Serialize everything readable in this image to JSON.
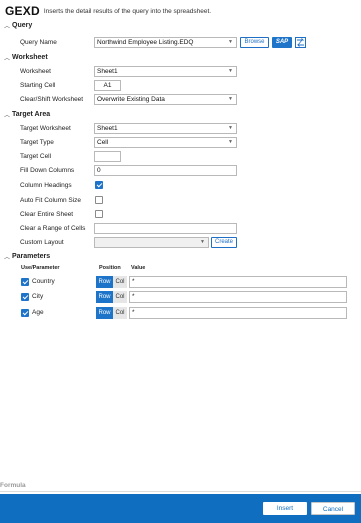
{
  "header": {
    "function_name": "GEXD",
    "description": "Inserts the detail results of the query into the spreadsheet."
  },
  "sections": {
    "query": "Query",
    "worksheet": "Worksheet",
    "target_area": "Target Area",
    "parameters": "Parameters"
  },
  "query": {
    "query_name_label": "Query Name",
    "query_name_value": "Northwind Employee Listing.EDQ",
    "browse_label": "Browse",
    "sap_label": "SAP"
  },
  "worksheet": {
    "worksheet_label": "Worksheet",
    "worksheet_value": "Sheet1",
    "starting_cell_label": "Starting Cell",
    "starting_cell_value": "A1",
    "clear_shift_label": "Clear/Shift Worksheet",
    "clear_shift_value": "Overwrite Existing Data"
  },
  "target_area": {
    "target_worksheet_label": "Target Worksheet",
    "target_worksheet_value": "Sheet1",
    "target_type_label": "Target Type",
    "target_type_value": "Cell",
    "target_cell_label": "Target Cell",
    "target_cell_value": "",
    "fill_down_label": "Fill Down Columns",
    "fill_down_value": "0",
    "column_headings_label": "Column Headings",
    "column_headings_checked": true,
    "auto_fit_label": "Auto Fit Column Size",
    "auto_fit_checked": false,
    "clear_entire_label": "Clear Entire Sheet",
    "clear_entire_checked": false,
    "clear_range_label": "Clear a Range of Cells",
    "clear_range_value": "",
    "custom_layout_label": "Custom Layout",
    "custom_layout_value": "",
    "create_label": "Create"
  },
  "parameters": {
    "col_use": "Use/Parameter",
    "col_position": "Position",
    "col_value": "Value",
    "rows": [
      {
        "name": "Country",
        "checked": true,
        "row_label": "Row",
        "col_label": "Col",
        "value": "*"
      },
      {
        "name": "City",
        "checked": true,
        "row_label": "Row",
        "col_label": "Col",
        "value": "*"
      },
      {
        "name": "Age",
        "checked": true,
        "row_label": "Row",
        "col_label": "Col",
        "value": "*"
      }
    ]
  },
  "formula": {
    "label": "Formula"
  },
  "footer": {
    "insert_label": "Insert",
    "cancel_label": "Cancel"
  },
  "icons": {
    "section_chevron": "chevron-up-icon",
    "dropdown_caret": "chevron-down-icon",
    "swap": "swap-icon"
  },
  "colors": {
    "accent": "#1d74c9",
    "footer": "#0f6ebf"
  }
}
